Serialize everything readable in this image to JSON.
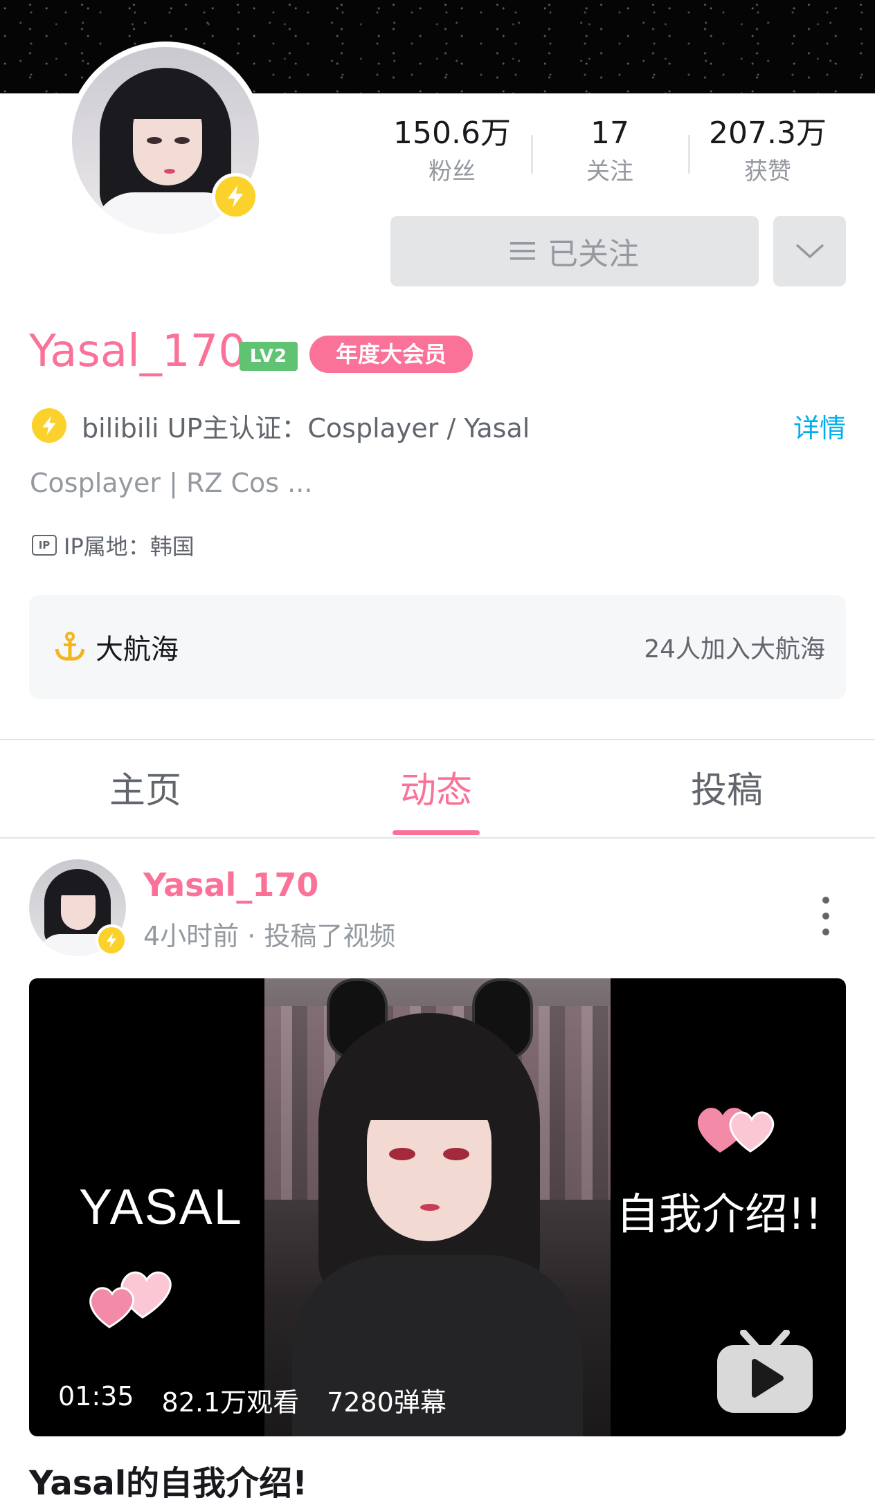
{
  "profile": {
    "username": "Yasal_170",
    "level_badge": "LV2",
    "vip_badge": "年度大会员",
    "stats": [
      {
        "value": "150.6万",
        "label": "粉丝"
      },
      {
        "value": "17",
        "label": "关注"
      },
      {
        "value": "207.3万",
        "label": "获赞"
      }
    ],
    "follow_button": "已关注",
    "verification": "bilibili UP主认证：Cosplayer / Yasal",
    "detail_link": "详情",
    "signature": "Cosplayer | RZ Cos ...",
    "ip_icon": "IP",
    "ip_location": "IP属地：韩国",
    "guard_title": "大航海",
    "guard_count": "24人加入大航海"
  },
  "tabs": [
    {
      "label": "主页",
      "active": false
    },
    {
      "label": "动态",
      "active": true
    },
    {
      "label": "投稿",
      "active": false
    }
  ],
  "post": {
    "author": "Yasal_170",
    "meta": "4小时前 · 投稿了视频",
    "video": {
      "left_text": "YASAL",
      "right_text": "自我介绍!!",
      "duration": "01:35",
      "views": "82.1万观看",
      "danmaku": "7280弹幕"
    },
    "title": "Yasal的自我介绍!"
  },
  "colors": {
    "brand_pink": "#fb7299",
    "link_blue": "#00aeec",
    "verify_yellow": "#fbd22b",
    "level_green": "#5fc373"
  },
  "icons": [
    "bolt-icon",
    "menu-lines-icon",
    "chevron-down-icon",
    "anchor-icon",
    "more-vertical-icon",
    "tv-play-icon",
    "heart-icon"
  ]
}
